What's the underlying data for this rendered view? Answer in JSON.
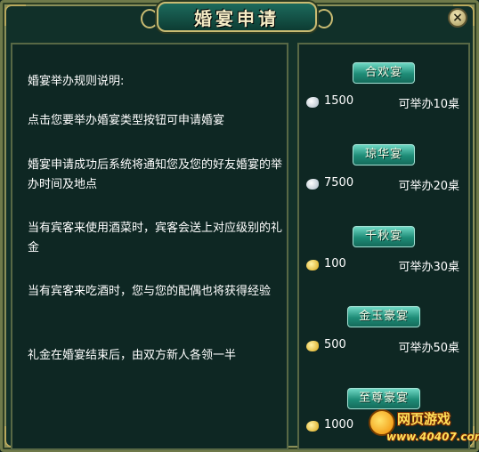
{
  "title": "婚宴申请",
  "close_label": "×",
  "rules": {
    "heading": "婚宴举办规则说明:",
    "items": [
      "点击您要举办婚宴类型按钮可申请婚宴",
      "婚宴申请成功后系统将通知您及您的好友婚宴的举办时间及地点",
      "当有宾客来使用酒菜时，宾客会送上对应级别的礼金",
      "当有宾客来吃酒时，您与您的配偶也将获得经验",
      "礼金在婚宴结束后，由双方新人各领一半"
    ]
  },
  "options": [
    {
      "label": "合欢宴",
      "currency_icon": "silver-coin-icon",
      "cost": "1500",
      "tables": "可举办10桌"
    },
    {
      "label": "琼华宴",
      "currency_icon": "silver-coin-icon",
      "cost": "7500",
      "tables": "可举办20桌"
    },
    {
      "label": "千秋宴",
      "currency_icon": "gold-ingot-icon",
      "cost": "100",
      "tables": "可举办30桌"
    },
    {
      "label": "金玉豪宴",
      "currency_icon": "gold-ingot-icon",
      "cost": "500",
      "tables": "可举办50桌"
    },
    {
      "label": "至尊豪宴",
      "currency_icon": "gold-ingot-icon",
      "cost": "1000",
      "tables": ""
    }
  ],
  "watermark": {
    "name": "网页游戏",
    "url": "www.40407.com"
  },
  "colors": {
    "panel_bg": "#0e2723",
    "frame_gold": "#c9bb72",
    "button_teal": "#1e8c77",
    "text": "#ffffff"
  }
}
